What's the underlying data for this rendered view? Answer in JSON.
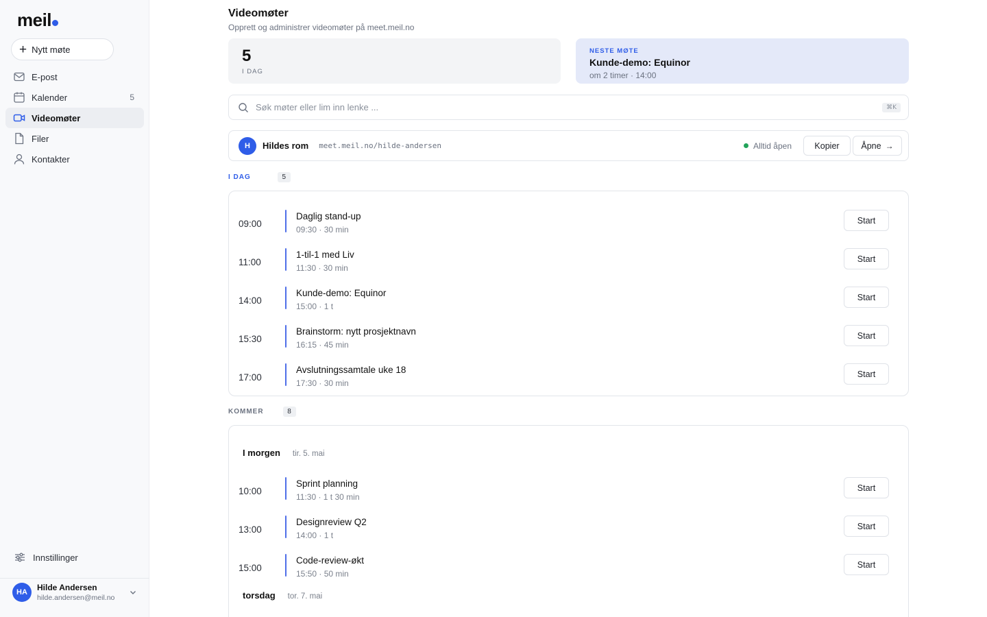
{
  "app": {
    "logo_text": "meil",
    "brand_color": "#2f5de8"
  },
  "sidebar": {
    "new_meeting_label": "Nytt møte",
    "items": [
      {
        "label": "E-post",
        "icon": "mail-icon",
        "count": ""
      },
      {
        "label": "Kalender",
        "icon": "calendar-icon",
        "count": "5"
      },
      {
        "label": "Videomøter",
        "icon": "video-icon",
        "count": "",
        "active": true
      },
      {
        "label": "Filer",
        "icon": "file-icon",
        "count": ""
      },
      {
        "label": "Kontakter",
        "icon": "user-icon",
        "count": ""
      }
    ],
    "settings_label": "Innstillinger",
    "user": {
      "initials": "HA",
      "name": "Hilde Andersen",
      "email": "hilde.andersen@meil.no"
    }
  },
  "header": {
    "title": "Videomøter",
    "subtitle": "Opprett og administrer videomøter på meet.meil.no"
  },
  "stats": {
    "today_count": "5",
    "today_label": "I DAG"
  },
  "next_meeting": {
    "kicker": "NESTE MØTE",
    "title": "Kunde-demo: Equinor",
    "time": "om 2 timer · 14:00"
  },
  "search": {
    "placeholder": "Søk møter eller lim inn lenke ...",
    "shortcut": "⌘K"
  },
  "room": {
    "initial": "H",
    "name": "Hildes rom",
    "url": "meet.meil.no/hilde-andersen",
    "status": "Alltid åpen",
    "copy_label": "Kopier",
    "open_label": "Åpne",
    "status_color": "#22a35a"
  },
  "today": {
    "label": "I DAG",
    "count": "5",
    "label_color": "#2f5de8",
    "meetings": [
      {
        "time": "09:00",
        "title": "Daglig stand-up",
        "meta": "09:30 · 30 min",
        "action": "Start"
      },
      {
        "time": "11:00",
        "title": "1-til-1 med Liv",
        "meta": "11:30 · 30 min",
        "action": "Start"
      },
      {
        "time": "14:00",
        "title": "Kunde-demo: Equinor",
        "meta": "15:00 · 1 t",
        "action": "Start"
      },
      {
        "time": "15:30",
        "title": "Brainstorm: nytt prosjektnavn",
        "meta": "16:15 · 45 min",
        "action": "Start"
      },
      {
        "time": "17:00",
        "title": "Avslutningssamtale uke 18",
        "meta": "17:30 · 30 min",
        "action": "Start"
      }
    ]
  },
  "upcoming": {
    "label": "KOMMER",
    "count": "8",
    "label_color": "#6b7280",
    "days": [
      {
        "name": "I morgen",
        "date": "tir. 5. mai",
        "meetings": [
          {
            "time": "10:00",
            "title": "Sprint planning",
            "meta": "11:30 · 1 t 30 min",
            "action": "Start"
          },
          {
            "time": "13:00",
            "title": "Designreview Q2",
            "meta": "14:00 · 1 t",
            "action": "Start"
          },
          {
            "time": "15:00",
            "title": "Code-review-økt",
            "meta": "15:50 · 50 min",
            "action": "Start"
          }
        ]
      },
      {
        "name": "torsdag",
        "date": "tor. 7. mai",
        "meetings": []
      }
    ]
  }
}
